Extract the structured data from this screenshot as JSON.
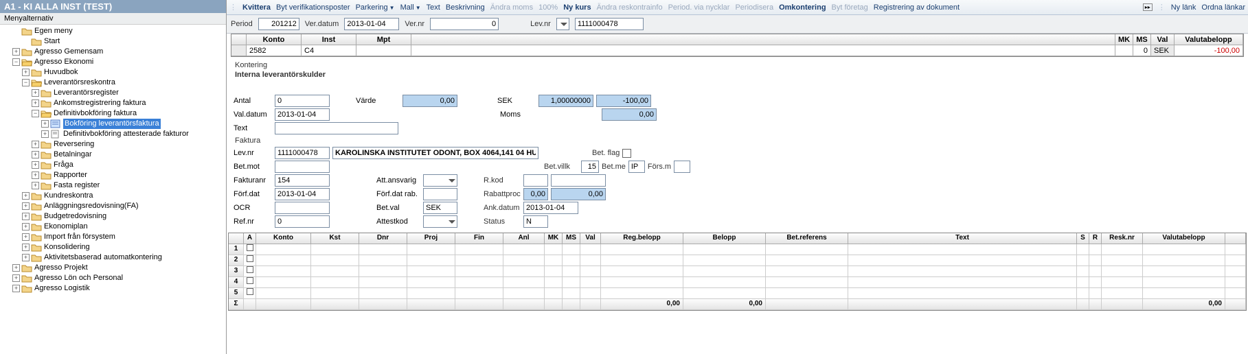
{
  "window_title": "A1 - KI ALLA INST  (TEST)",
  "menu_label": "Menyalternativ",
  "tree": {
    "n0": "Egen meny",
    "n1": "Start",
    "n2": "Agresso Gemensam",
    "n3": "Agresso Ekonomi",
    "n4": "Huvudbok",
    "n5": "Leverantörsreskontra",
    "n6": "Leverantörsregister",
    "n7": "Ankomstregistrering faktura",
    "n8": "Definitivbokföring faktura",
    "n9": "Bokföring leverantörsfaktura",
    "n10": "Definitivbokföring attesterade fakturor",
    "n11": "Reversering",
    "n12": "Betalningar",
    "n13": "Fråga",
    "n14": "Rapporter",
    "n15": "Fasta register",
    "n16": "Kundreskontra",
    "n17": "Anläggningsredovisning(FA)",
    "n18": "Budgetredovisning",
    "n19": "Ekonomiplan",
    "n20": "Import från försystem",
    "n21": "Konsolidering",
    "n22": "Aktivitetsbaserad automatkontering",
    "n23": "Agresso Projekt",
    "n24": "Agresso Lön och Personal",
    "n25": "Agresso Logistik"
  },
  "toolbar": {
    "kvittera": "Kvittera",
    "bytver": "Byt verifikationsposter",
    "parkering": "Parkering",
    "mall": "Mall",
    "text": "Text",
    "beskriv": "Beskrivning",
    "andramoms": "Ändra moms",
    "hundra": "100%",
    "nykurs": "Ny kurs",
    "andrares": "Ändra reskontrainfo",
    "periodvia": "Period. via nycklar",
    "periodisera": "Periodisera",
    "omkont": "Omkontering",
    "bytfor": "Byt företag",
    "regdok": "Registrering av dokument",
    "nylank": "Ny länk",
    "ordna": "Ordna länkar"
  },
  "header": {
    "period_l": "Period",
    "period_v": "201212",
    "verdat_l": "Ver.datum",
    "verdat_v": "2013-01-04",
    "vernr_l": "Ver.nr",
    "vernr_v": "0",
    "levnr_l": "Lev.nr",
    "levnr_v": "1111000478"
  },
  "minigrid": {
    "konto_h": "Konto",
    "inst_h": "Inst",
    "mpt_h": "Mpt",
    "mk_h": "MK",
    "ms_h": "MS",
    "val_h": "Val",
    "valb_h": "Valutabelopp",
    "konto_v": "2582",
    "inst_v": "C4",
    "mpt_v": "",
    "mk_v": "",
    "ms_v": "0",
    "val_v": "SEK",
    "valb_v": "-100,00"
  },
  "kontering": {
    "title": "Kontering",
    "sub": "Interna leverantörskulder",
    "antal_l": "Antal",
    "antal_v": "0",
    "varde_l": "Värde",
    "varde_v": "0,00",
    "sek_l": "SEK",
    "sek_rate": "1,00000000",
    "sek_amt": "-100,00",
    "valdat_l": "Val.datum",
    "valdat_v": "2013-01-04",
    "moms_l": "Moms",
    "moms_v": "0,00",
    "text_l": "Text",
    "text_v": "",
    "faktura_title": "Faktura",
    "levnr_l": "Lev.nr",
    "levnr_v": "1111000478",
    "levnamn": "KAROLINSKA INSTITUTET ODONT, BOX 4064,141 04 HU",
    "betflag_l": "Bet. flag",
    "betmot_l": "Bet.mot",
    "betvillk_l": "Bet.villk",
    "betvillk_v": "15",
    "betme_l": "Bet.me",
    "betme_v": "IP",
    "forsm_l": "Förs.m",
    "faknr_l": "Fakturanr",
    "faknr_v": "154",
    "attansv_l": "Att.ansvarig",
    "rkod_l": "R.kod",
    "forfdat_l": "Förf.dat",
    "forfdat_v": "2013-01-04",
    "forfrab_l": "Förf.dat rab.",
    "rabproc_l": "Rabattproc",
    "rabproc_v1": "0,00",
    "rabproc_v2": "0,00",
    "ocr_l": "OCR",
    "betval_l": "Bet.val",
    "betval_v": "SEK",
    "ankdat_l": "Ank.datum",
    "ankdat_v": "2013-01-04",
    "refnr_l": "Ref.nr",
    "refnr_v": "0",
    "attkod_l": "Attestkod",
    "status_l": "Status",
    "status_v": "N"
  },
  "lowgrid": {
    "cols": {
      "a": "A",
      "konto": "Konto",
      "kst": "Kst",
      "dnr": "Dnr",
      "proj": "Proj",
      "fin": "Fin",
      "anl": "Anl",
      "mk": "MK",
      "ms": "MS",
      "val": "Val",
      "regb": "Reg.belopp",
      "belopp": "Belopp",
      "betref": "Bet.referens",
      "text": "Text",
      "s": "S",
      "r": "R",
      "resk": "Resk.nr",
      "valb": "Valutabelopp"
    },
    "rows": [
      "1",
      "2",
      "3",
      "4",
      "5"
    ],
    "sigma": "Σ",
    "sum_regb": "0,00",
    "sum_belopp": "0,00",
    "sum_valb": "0,00"
  }
}
